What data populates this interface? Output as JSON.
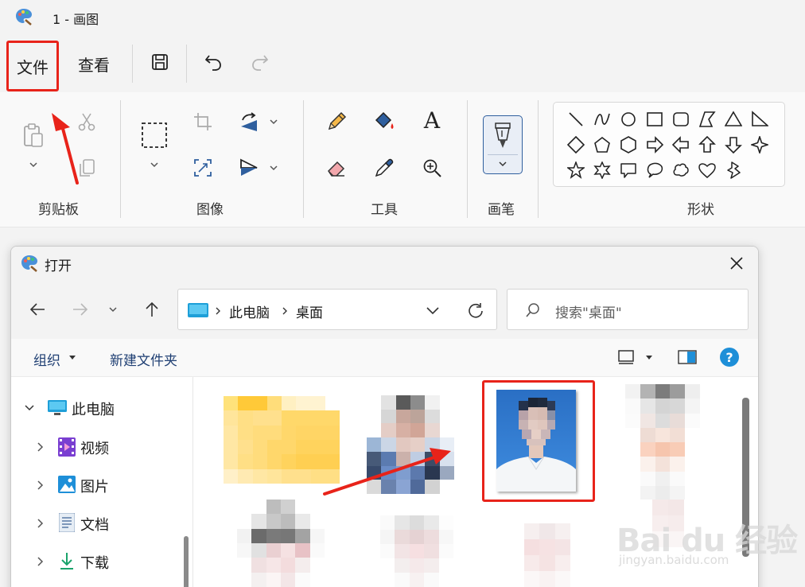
{
  "app": {
    "title": "1 - 画图"
  },
  "menu": {
    "file_label": "文件",
    "view_label": "查看"
  },
  "ribbon": {
    "groups": {
      "clipboard": "剪贴板",
      "image": "图像",
      "tools": "工具",
      "brushes": "画笔",
      "shapes": "形状"
    },
    "text_tool_glyph": "A"
  },
  "dialog": {
    "title": "打开",
    "breadcrumb": [
      "此电脑",
      "桌面"
    ],
    "search_placeholder": "搜索\"桌面\"",
    "commands": {
      "organize": "组织",
      "new_folder": "新建文件夹"
    },
    "tree": [
      {
        "label": "此电脑",
        "expanded": true
      },
      {
        "label": "视频"
      },
      {
        "label": "图片"
      },
      {
        "label": "文档"
      },
      {
        "label": "下载"
      }
    ]
  },
  "watermark": {
    "main": "Bai du 经验",
    "sub": "jingyan.baidu.com"
  },
  "colors": {
    "annotation_red": "#e8231a",
    "photo_blue_bg": "#2f78cc",
    "folder_yellow": "#ffd25a",
    "accent_blue": "#0a64b8"
  }
}
